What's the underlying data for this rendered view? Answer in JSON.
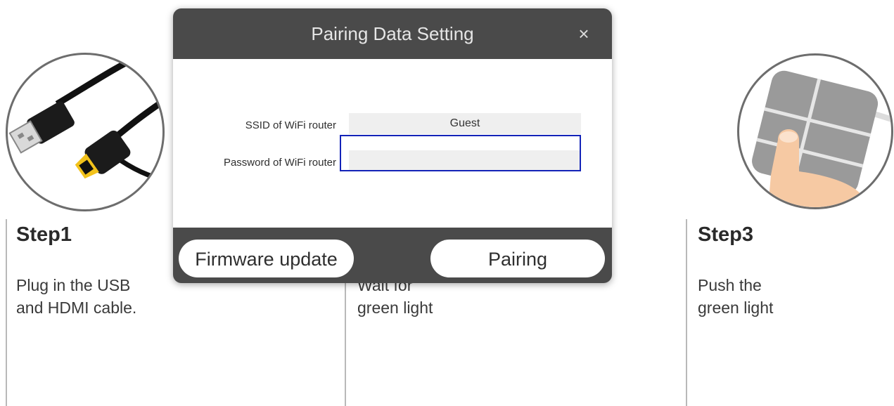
{
  "steps": [
    {
      "title": "Step1",
      "description": "Plug in the USB\nand HDMI cable."
    },
    {
      "title": "",
      "description": "Wait for\ngreen light"
    },
    {
      "title": "Step3",
      "description": "Push the\ngreen light"
    }
  ],
  "dialog": {
    "title": "Pairing Data Setting",
    "close_icon": "×",
    "ssid_label": "SSID of WiFi router",
    "ssid_value": "Guest",
    "password_label": "Password of WiFi router",
    "password_value": "",
    "firmware_button": "Firmware update",
    "pairing_button": "Pairing"
  },
  "colors": {
    "dialog_bg": "#4a4a4a",
    "focus_ring": "#1323b8",
    "field_bg": "#efefef",
    "hdmi_gold": "#f2c21b"
  },
  "icons": [
    "usb-hdmi-cable-icon",
    "device-button-press-icon",
    "close-icon"
  ]
}
